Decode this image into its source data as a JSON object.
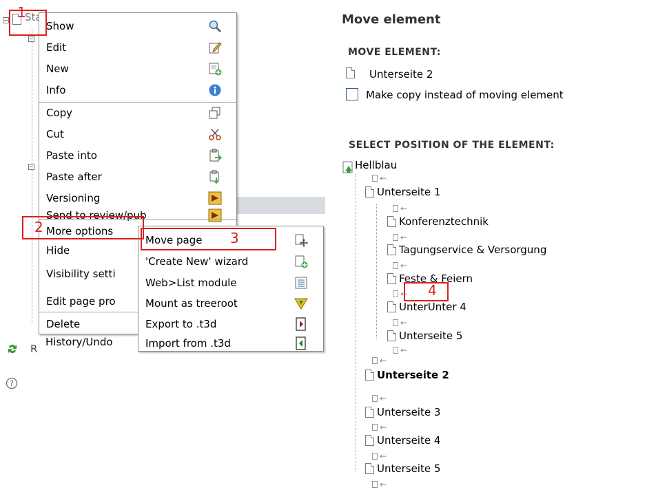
{
  "background": {
    "root_label": "Startseite",
    "reload_initial": "R"
  },
  "context_menu": {
    "items": [
      {
        "label": "Show",
        "icon": "magnifier-icon"
      },
      {
        "label": "Edit",
        "icon": "pencil-icon"
      },
      {
        "label": "New",
        "icon": "new-record-icon"
      },
      {
        "label": "Info",
        "icon": "info-icon"
      },
      {
        "label": "Copy",
        "icon": "copy-icon"
      },
      {
        "label": "Cut",
        "icon": "scissors-icon"
      },
      {
        "label": "Paste into",
        "icon": "paste-into-icon"
      },
      {
        "label": "Paste after",
        "icon": "paste-after-icon"
      },
      {
        "label": "Versioning",
        "icon": "versioning-icon"
      },
      {
        "label": "Send to review/pub",
        "icon": "review-icon"
      },
      {
        "label": "More options",
        "icon": ""
      },
      {
        "label": "Hide",
        "icon": ""
      },
      {
        "label": "Visibility setti",
        "icon": ""
      },
      {
        "label": "Edit page pro",
        "icon": ""
      },
      {
        "label": "Delete",
        "icon": ""
      },
      {
        "label": "History/Undo",
        "icon": ""
      }
    ]
  },
  "submenu": {
    "items": [
      {
        "label": "Move page",
        "icon": "move-icon"
      },
      {
        "label": "'Create New' wizard",
        "icon": "create-wizard-icon"
      },
      {
        "label": "Web>List module",
        "icon": "list-module-icon"
      },
      {
        "label": "Mount as treeroot",
        "icon": "mount-icon"
      },
      {
        "label": "Export to .t3d",
        "icon": "export-icon"
      },
      {
        "label": "Import from .t3d",
        "icon": "import-icon"
      }
    ]
  },
  "annotations": {
    "n1": "1",
    "n2": "2",
    "n3": "3",
    "n4": "4"
  },
  "move_panel": {
    "title": "Move element",
    "move_heading": "MOVE ELEMENT:",
    "element_name": "Unterseite 2",
    "copy_label": "Make copy instead of moving element",
    "select_heading": "SELECT POSITION OF THE ELEMENT:",
    "tree": {
      "root": "Hellblau",
      "nodes": [
        {
          "label": "Unterseite 1"
        },
        {
          "label": "Konferenztechnik"
        },
        {
          "label": "Tagungservice & Versorgung"
        },
        {
          "label": "Feste & Feiern"
        },
        {
          "label": "UnterUnter 4"
        },
        {
          "label": "Unterseite 5"
        },
        {
          "label": "Unterseite 2"
        },
        {
          "label": "Unterseite 3"
        },
        {
          "label": "Unterseite 4"
        },
        {
          "label": "Unterseite 5"
        }
      ]
    }
  },
  "colors": {
    "annotation_red": "#d92020",
    "heading_grey": "#333333"
  }
}
